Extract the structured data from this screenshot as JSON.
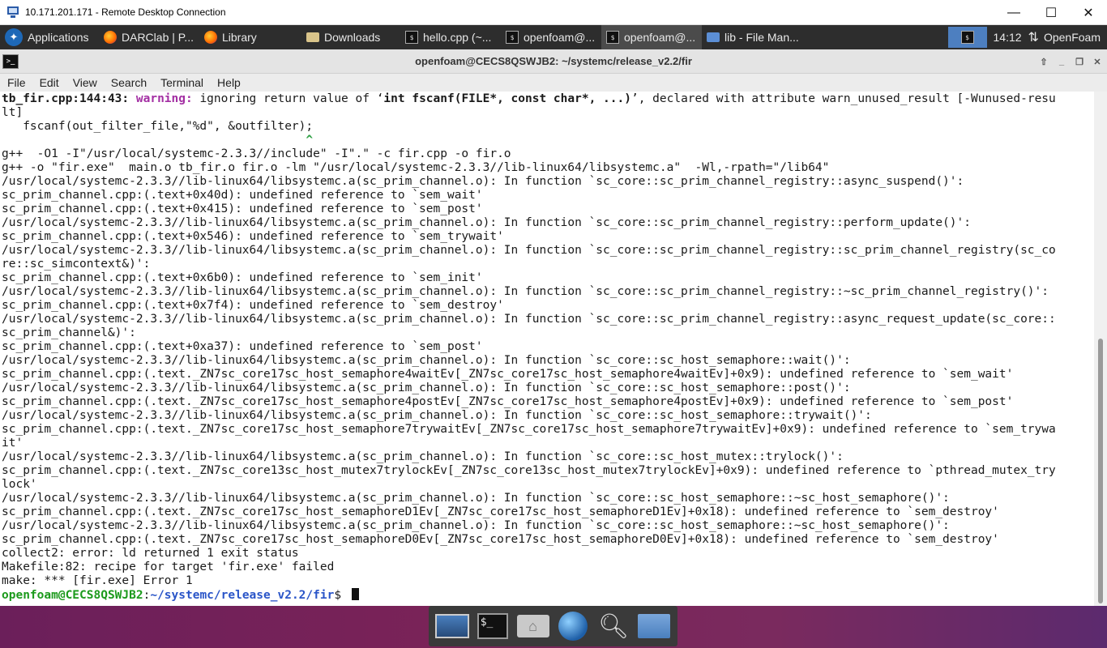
{
  "rdp": {
    "title": "10.171.201.171 - Remote Desktop Connection",
    "min_glyph": "—",
    "max_glyph": "☐",
    "close_glyph": "✕"
  },
  "panel": {
    "applications_label": "Applications",
    "tasks": [
      {
        "label": "DARClab | P...",
        "icon": "firefox-icon"
      },
      {
        "label": "Library",
        "icon": "firefox-icon"
      },
      {
        "label": "Downloads",
        "icon": "folder-icon"
      },
      {
        "label": "hello.cpp (~...",
        "icon": "terminal-icon"
      },
      {
        "label": "openfoam@...",
        "icon": "terminal-icon"
      },
      {
        "label": "openfoam@...",
        "icon": "terminal-icon",
        "active": true
      },
      {
        "label": "lib - File Man...",
        "icon": "file-manager-icon"
      }
    ],
    "clock": "14:12",
    "user": "OpenFoam"
  },
  "terminal": {
    "title": "openfoam@CECS8QSWJB2: ~/systemc/release_v2.2/fir",
    "menu": [
      "File",
      "Edit",
      "View",
      "Search",
      "Terminal",
      "Help"
    ],
    "warning_prefix": "tb_fir.cpp:144:43: ",
    "warning_word": "warning:",
    "warning_text_a": " ignoring return value of ‘",
    "warning_bold": "int fscanf(FILE*, const char*, ...)",
    "warning_text_b": "’, declared with attribute warn_unused_result [-Wunused-resu",
    "lines": [
      "lt]",
      "   fscanf(out_filter_file,\"%d\", &outfilter);",
      "__CARET__",
      "g++  -O1 -I\"/usr/local/systemc-2.3.3//include\" -I\".\" -c fir.cpp -o fir.o",
      "g++ -o \"fir.exe\"  main.o tb_fir.o fir.o -lm \"/usr/local/systemc-2.3.3//lib-linux64/libsystemc.a\"  -Wl,-rpath=\"/lib64\"",
      "/usr/local/systemc-2.3.3//lib-linux64/libsystemc.a(sc_prim_channel.o): In function `sc_core::sc_prim_channel_registry::async_suspend()':",
      "sc_prim_channel.cpp:(.text+0x40d): undefined reference to `sem_wait'",
      "sc_prim_channel.cpp:(.text+0x415): undefined reference to `sem_post'",
      "/usr/local/systemc-2.3.3//lib-linux64/libsystemc.a(sc_prim_channel.o): In function `sc_core::sc_prim_channel_registry::perform_update()':",
      "sc_prim_channel.cpp:(.text+0x546): undefined reference to `sem_trywait'",
      "/usr/local/systemc-2.3.3//lib-linux64/libsystemc.a(sc_prim_channel.o): In function `sc_core::sc_prim_channel_registry::sc_prim_channel_registry(sc_co",
      "re::sc_simcontext&)':",
      "sc_prim_channel.cpp:(.text+0x6b0): undefined reference to `sem_init'",
      "/usr/local/systemc-2.3.3//lib-linux64/libsystemc.a(sc_prim_channel.o): In function `sc_core::sc_prim_channel_registry::~sc_prim_channel_registry()':",
      "sc_prim_channel.cpp:(.text+0x7f4): undefined reference to `sem_destroy'",
      "/usr/local/systemc-2.3.3//lib-linux64/libsystemc.a(sc_prim_channel.o): In function `sc_core::sc_prim_channel_registry::async_request_update(sc_core::",
      "sc_prim_channel&)':",
      "sc_prim_channel.cpp:(.text+0xa37): undefined reference to `sem_post'",
      "/usr/local/systemc-2.3.3//lib-linux64/libsystemc.a(sc_prim_channel.o): In function `sc_core::sc_host_semaphore::wait()':",
      "sc_prim_channel.cpp:(.text._ZN7sc_core17sc_host_semaphore4waitEv[_ZN7sc_core17sc_host_semaphore4waitEv]+0x9): undefined reference to `sem_wait'",
      "/usr/local/systemc-2.3.3//lib-linux64/libsystemc.a(sc_prim_channel.o): In function `sc_core::sc_host_semaphore::post()':",
      "sc_prim_channel.cpp:(.text._ZN7sc_core17sc_host_semaphore4postEv[_ZN7sc_core17sc_host_semaphore4postEv]+0x9): undefined reference to `sem_post'",
      "/usr/local/systemc-2.3.3//lib-linux64/libsystemc.a(sc_prim_channel.o): In function `sc_core::sc_host_semaphore::trywait()':",
      "sc_prim_channel.cpp:(.text._ZN7sc_core17sc_host_semaphore7trywaitEv[_ZN7sc_core17sc_host_semaphore7trywaitEv]+0x9): undefined reference to `sem_trywa",
      "it'",
      "/usr/local/systemc-2.3.3//lib-linux64/libsystemc.a(sc_prim_channel.o): In function `sc_core::sc_host_mutex::trylock()':",
      "sc_prim_channel.cpp:(.text._ZN7sc_core13sc_host_mutex7trylockEv[_ZN7sc_core13sc_host_mutex7trylockEv]+0x9): undefined reference to `pthread_mutex_try",
      "lock'",
      "/usr/local/systemc-2.3.3//lib-linux64/libsystemc.a(sc_prim_channel.o): In function `sc_core::sc_host_semaphore::~sc_host_semaphore()':",
      "sc_prim_channel.cpp:(.text._ZN7sc_core17sc_host_semaphoreD1Ev[_ZN7sc_core17sc_host_semaphoreD1Ev]+0x18): undefined reference to `sem_destroy'",
      "/usr/local/systemc-2.3.3//lib-linux64/libsystemc.a(sc_prim_channel.o): In function `sc_core::sc_host_semaphore::~sc_host_semaphore()':",
      "sc_prim_channel.cpp:(.text._ZN7sc_core17sc_host_semaphoreD0Ev[_ZN7sc_core17sc_host_semaphoreD0Ev]+0x18): undefined reference to `sem_destroy'",
      "collect2: error: ld returned 1 exit status",
      "Makefile:82: recipe for target 'fir.exe' failed",
      "make: *** [fir.exe] Error 1"
    ],
    "caret_char": "^",
    "prompt_user": "openfoam@CECS8QSWJB2",
    "prompt_colon": ":",
    "prompt_path": "~/systemc/release_v2.2/fir",
    "prompt_dollar": "$ "
  },
  "colors": {
    "warning": "#a32fa3",
    "prompt_user": "#1c9a1c",
    "prompt_path": "#2a55c8",
    "panel_bg": "#2d2d2d"
  },
  "dock": {
    "items": [
      "desktop-icon",
      "terminal-icon",
      "home-folder-icon",
      "web-browser-icon",
      "search-icon",
      "folder-icon"
    ],
    "terminal_glyph": "$_",
    "home_glyph": "⌂"
  }
}
